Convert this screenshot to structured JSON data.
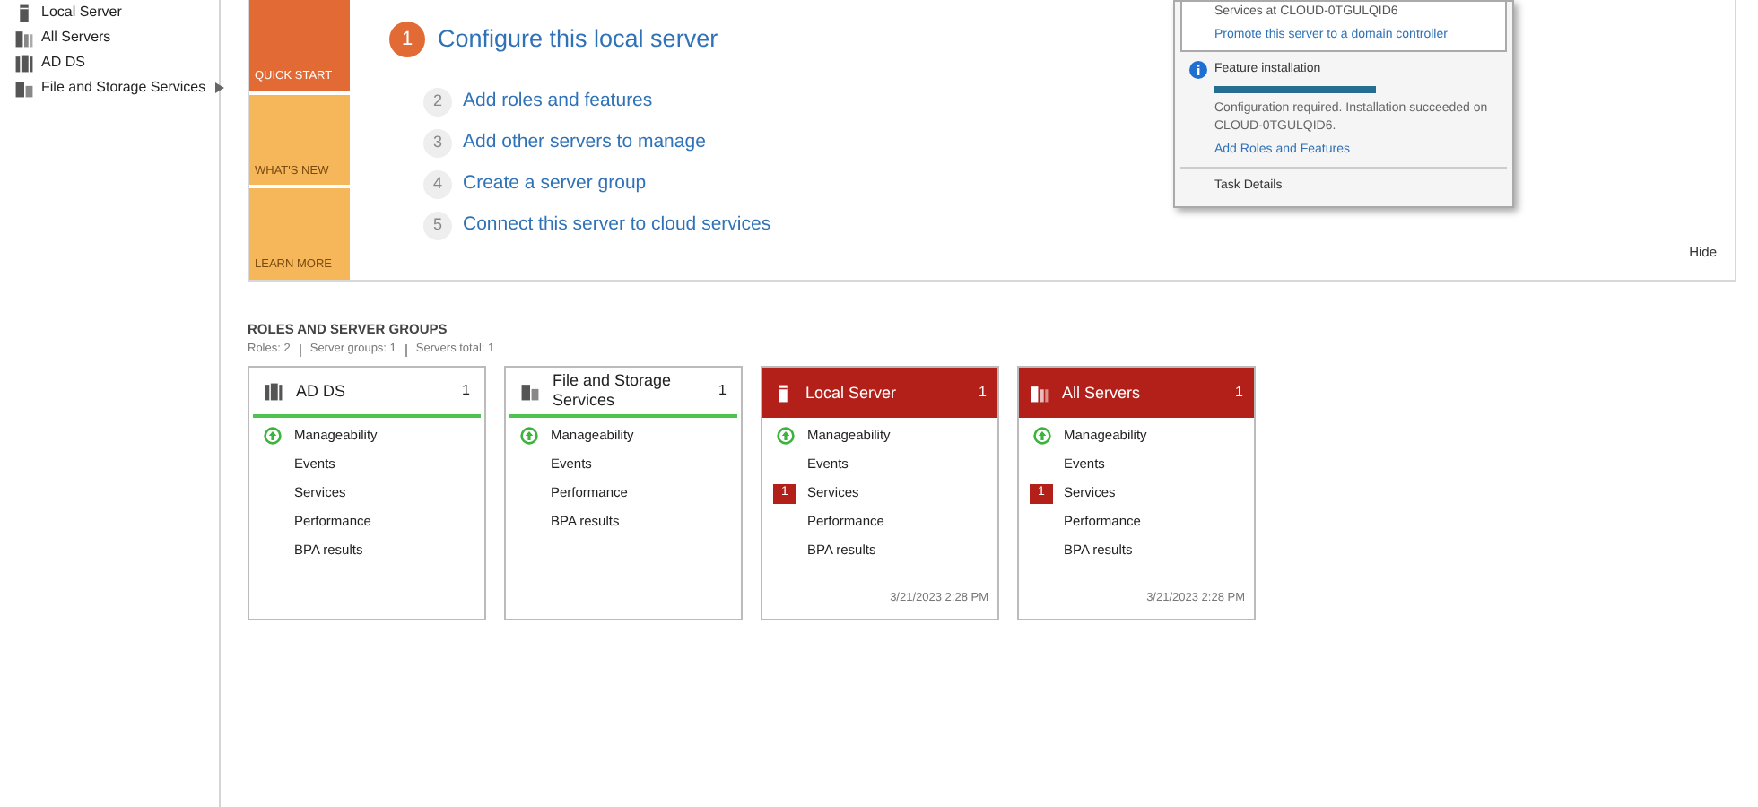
{
  "sidebar": {
    "items": [
      {
        "label": "Local Server",
        "expandable": false
      },
      {
        "label": "All Servers",
        "expandable": false
      },
      {
        "label": "AD DS",
        "expandable": false
      },
      {
        "label": "File and Storage Services",
        "expandable": true
      }
    ]
  },
  "quick_start": {
    "tiles": [
      {
        "label": "QUICK START",
        "selected": true
      },
      {
        "label": "WHAT'S NEW",
        "selected": false
      },
      {
        "label": "LEARN MORE",
        "selected": false
      }
    ],
    "steps": [
      {
        "number": "1",
        "label": "Configure this local server",
        "selected": true
      },
      {
        "number": "2",
        "label": "Add roles and features",
        "selected": false
      },
      {
        "number": "3",
        "label": "Add other servers to manage",
        "selected": false
      },
      {
        "number": "4",
        "label": "Create a server group",
        "selected": false
      },
      {
        "number": "5",
        "label": "Connect this server to cloud services",
        "selected": false
      }
    ],
    "hide": "Hide"
  },
  "notifications": {
    "first": {
      "text": "Services at CLOUD-0TGULQID6",
      "link": "Promote this server to a domain controller"
    },
    "second": {
      "title": "Feature installation",
      "level": 1,
      "text": "Configuration required. Installation succeeded on CLOUD-0TGULQID6.",
      "link": "Add Roles and Features"
    },
    "task_details": "Task Details"
  },
  "roles": {
    "title": "ROLES AND SERVER GROUPS",
    "summary": [
      "Roles: 2",
      "Server groups: 1",
      "Servers total: 1"
    ],
    "cards": [
      {
        "title": "AD DS",
        "count": "1",
        "alert": false,
        "rows": [
          {
            "label": "Manageability",
            "kind": "ok"
          },
          {
            "label": "Events",
            "kind": "plain"
          },
          {
            "label": "Services",
            "kind": "plain"
          },
          {
            "label": "Performance",
            "kind": "plain"
          },
          {
            "label": "BPA results",
            "kind": "plain"
          }
        ]
      },
      {
        "title": "File and Storage Services",
        "count": "1",
        "alert": false,
        "rows": [
          {
            "label": "Manageability",
            "kind": "ok"
          },
          {
            "label": "Events",
            "kind": "plain"
          },
          {
            "label": "Performance",
            "kind": "plain"
          },
          {
            "label": "BPA results",
            "kind": "plain"
          }
        ]
      },
      {
        "title": "Local Server",
        "count": "1",
        "alert": true,
        "rows": [
          {
            "label": "Manageability",
            "kind": "ok"
          },
          {
            "label": "Events",
            "kind": "plain"
          },
          {
            "label": "Services",
            "kind": "alert",
            "badge": "1"
          },
          {
            "label": "Performance",
            "kind": "plain"
          },
          {
            "label": "BPA results",
            "kind": "plain"
          }
        ],
        "timestamp": "3/21/2023 2:28 PM"
      },
      {
        "title": "All Servers",
        "count": "1",
        "alert": true,
        "rows": [
          {
            "label": "Manageability",
            "kind": "ok"
          },
          {
            "label": "Events",
            "kind": "plain"
          },
          {
            "label": "Services",
            "kind": "alert",
            "badge": "1"
          },
          {
            "label": "Performance",
            "kind": "plain"
          },
          {
            "label": "BPA results",
            "kind": "plain"
          }
        ],
        "timestamp": "3/21/2023 2:28 PM"
      }
    ]
  }
}
